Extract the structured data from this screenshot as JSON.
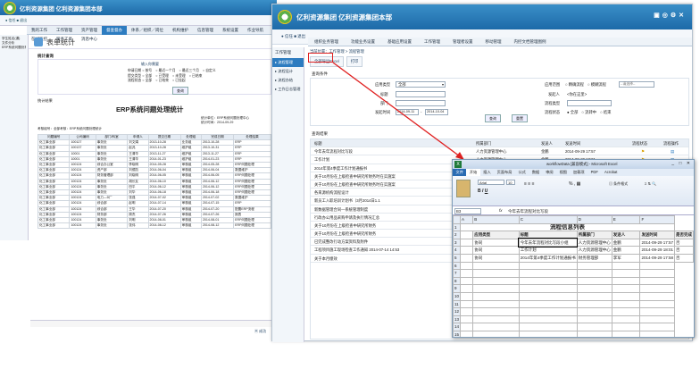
{
  "company_title": "亿利资源集团 亿利资源集团本部",
  "back_win": {
    "nav_tabs": [
      "我的工作",
      "工作管理",
      "资产管理",
      "督查督办",
      "体系／组织／岗位",
      "机构维护",
      "信息管理",
      "系统设置",
      "作业导航",
      "在线监控",
      "服务工具",
      "消息中心"
    ],
    "active_tab_index": 3,
    "page_title": "表单统计",
    "side_items": [
      "学生姓名(课)",
      "文件分析",
      "ERP系统问题处理统计"
    ],
    "search_label": "统计查询",
    "filter_title": "输入你需要",
    "filter_rows": [
      [
        "申请日期 ○ 按号",
        "○ 最近一个月",
        "○ 最近三个月",
        "○ 自定义"
      ],
      [
        "提交类型 ○ 全部",
        "○ 已受理",
        "○ 未受理",
        "○ 已结束"
      ],
      [
        "流程状态 ○ 全部",
        "○ 已结束",
        "○ 已挂起"
      ]
    ],
    "query_btn": "查询",
    "result_label": "统计结果",
    "report_title": "ERP系统问题处理统计",
    "report_meta": [
      "统计单位：ERP系统问题处理中心",
      "统计时间：2014-09-29"
    ],
    "report_sub": "考核组号：全部考核：ERP系统问题处理统计",
    "columns": [
      "问题编号",
      "公司编码",
      "部门/科室",
      "申请人",
      "提交日期",
      "处理组",
      "完成日期",
      "处理结果"
    ],
    "rows": [
      [
        "化工事业部",
        "100127",
        "事务处",
        "刘文娟",
        "2013-10-28",
        "业务组",
        "2013-10-28",
        "ERP"
      ],
      [
        "化工事业部",
        "100137",
        "事务处",
        "赵兆",
        "2013-10-28",
        "维护组",
        "2013-10-31",
        "ERP"
      ],
      [
        "化工事业部",
        "10001",
        "事务处",
        "王清华",
        "2013-11-27",
        "维护组",
        "2013-11-27",
        "ERP"
      ],
      [
        "化工事业部",
        "10001",
        "事务处",
        "王清华",
        "2014-01-23",
        "维护组",
        "2014-01-23",
        "ERP"
      ],
      [
        "化工事业部",
        "100124",
        "综合办公室",
        "李晓明",
        "2014-05-28",
        "审核组",
        "2014-05-28",
        "ERP问题处理"
      ],
      [
        "化工事业部",
        "100124",
        "资产部",
        "刘德凯",
        "2014-06-04",
        "审核组",
        "2014-06-04",
        "数据维护"
      ],
      [
        "化工事业部",
        "100124",
        "财务管理部",
        "刘晓明",
        "2014-06-05",
        "审核组",
        "2014-06-05",
        "ERP问题处理"
      ],
      [
        "化工事业部",
        "100124",
        "事务处",
        "胡长友",
        "2014-06-10",
        "审核组",
        "2014-06-12",
        "ERP问题处理"
      ],
      [
        "化工事业部",
        "100124",
        "事务处",
        "田平",
        "2014-06-12",
        "审核组",
        "2014-06-12",
        "ERP问题处理"
      ],
      [
        "化工事业部",
        "100124",
        "事务处",
        "刘华",
        "2014-06-18",
        "审核组",
        "2014-06-18",
        "ERP问题处理"
      ],
      [
        "化工事业部",
        "100124",
        "电力—D厂",
        "张强",
        "2014-07-02",
        "审核组",
        "2014-07-02",
        "数据维护"
      ],
      [
        "化工事业部",
        "100124",
        "综合部",
        "赵明",
        "2014-07-14",
        "审核组",
        "2014-07-15",
        "ERP"
      ],
      [
        "化工事业部",
        "100124",
        "综合部",
        "王华",
        "2014-07-20",
        "审核组",
        "2014-07-20",
        "配置ERP流程"
      ],
      [
        "化工事业部",
        "100124",
        "财务部",
        "周杰",
        "2014-07-26",
        "审核组",
        "2014-07-26",
        "报表"
      ],
      [
        "化工事业部",
        "100124",
        "事务处",
        "刘明",
        "2014-08-01",
        "审核组",
        "2014-08-01",
        "ERP问题处理"
      ],
      [
        "化工事业部",
        "100124",
        "事务处",
        "张伟",
        "2014-08-12",
        "审核组",
        "2014-08-12",
        "ERP问题处理"
      ]
    ]
  },
  "front_win": {
    "nav_tabs": [
      "组织业务管理",
      "功能业务设置",
      "基础应用设置",
      "工作管理",
      "管理者设置",
      "移动管理",
      "内控文档管理图例"
    ],
    "sidebar_title": "工作管理",
    "side_items": [
      "流程管理",
      "流程设计",
      "流程办结",
      "工作日志管理"
    ],
    "active_side_index": 0,
    "breadcrumb": "当前位置：工作管理 > 流程管理",
    "tool_tabs": [
      "全部导出Excel",
      "打印"
    ],
    "cond_label": "查询条件",
    "form": {
      "apply_type_label": "应用类型",
      "apply_type_value": "全部",
      "title_label": "标题",
      "title_value": "",
      "dept_label": "部门",
      "dept_value": "",
      "date_label": "发起时间",
      "date_from": "2014-09-11",
      "date_to": "2014-10-04",
      "scope_label": "应用范围",
      "scope_opts": [
        "○ 精确流程",
        "○ 模糊流程"
      ],
      "scope_placeholder": "--请选择--",
      "initiator_label": "发起人",
      "initiator_value": "<你在这里>",
      "flow_type_label": "流程类型",
      "flow_state_label": "流程状态",
      "flow_state_opts": [
        "● 全部",
        "○ 流转中",
        "○ 结束"
      ],
      "query_btn": "查询",
      "reset_btn": "重置"
    },
    "result_label": "查询结果",
    "list_headers": [
      "标题",
      "所属部门",
      "发送人",
      "发送时间",
      "流程状态",
      "流程操作"
    ],
    "list_rows": [
      {
        "title": "今年去年流程对比写段",
        "dept": "人力资源管理中心",
        "sender": "金鹏",
        "time": "2014-09-29 17:57"
      },
      {
        "title": "工作计划",
        "dept": "人力资源管理中心",
        "sender": "金鹏",
        "time": "2014-09-29 18:01"
      },
      {
        "title": "2014年第4季度工作计划通报书",
        "dept": "",
        "sender": "",
        "time": ""
      },
      {
        "title": "关于10月份在上级检查中研究所财务时在实施案",
        "dept": "",
        "sender": "",
        "time": ""
      },
      {
        "title": "关于10月份在上级检查中研究所财务时在实施案",
        "dept": "",
        "sender": "",
        "time": ""
      },
      {
        "title": "各来源机构流程设计",
        "dept": "",
        "sender": "",
        "time": ""
      },
      {
        "title": "新员工入职培训计划书（3月2014日1.1",
        "dept": "",
        "sender": "",
        "time": ""
      },
      {
        "title": "新数据管理合同—系统管理制度",
        "dept": "",
        "sender": "",
        "time": ""
      },
      {
        "title": "行政办公用品采购申请及执行情况汇总",
        "dept": "",
        "sender": "",
        "time": ""
      },
      {
        "title": "关于10月份在上级检查中研究所财务",
        "dept": "",
        "sender": "",
        "time": ""
      },
      {
        "title": "关于10月份在上级检查中研究所财务",
        "dept": "",
        "sender": "",
        "time": ""
      },
      {
        "title": "已完成整改行动方案资料及附件",
        "dept": "",
        "sender": "",
        "time": ""
      },
      {
        "title": "工程项目施工现场检查工作通知 2014-07-14 14:53",
        "dept": "",
        "sender": "",
        "time": ""
      },
      {
        "title": "关于本月绩效",
        "dept": "",
        "sender": "",
        "time": ""
      }
    ],
    "status_bar": [
      "成功(0)",
      "通知(0)"
    ]
  },
  "excel": {
    "title": "workflowData [兼容模式] - Microsoft Excel",
    "ribbon_tabs": [
      "文件",
      "开始",
      "插入",
      "页面布局",
      "公式",
      "数据",
      "审阅",
      "视图",
      "加载项",
      "PDF",
      "Acrobat"
    ],
    "font_name": "Arial",
    "font_size": "10",
    "namebox": "B3",
    "formula": "今年去年流程对比写段",
    "sheet_title": "流程信息列表",
    "headers": [
      "应用类型",
      "标题",
      "所属部门",
      "发送人",
      "发送时间",
      "是否完成"
    ],
    "rows": [
      [
        "协同",
        "今年去年流程对比写段小组",
        "人力资源管理中心",
        "金鹏",
        "2014-09-29 17:57",
        "否"
      ],
      [
        "协同",
        "工作计划",
        "人力资源管理中心",
        "金鹏",
        "2014-09-29 18:01",
        "否"
      ],
      [
        "协同",
        "2014年第4季度工作计划通报书",
        "财务管理部",
        "李军",
        "2014-09-29 17:58",
        "否"
      ]
    ]
  },
  "colors": {
    "accent": "#2d7cc0",
    "arrow": "#e02020",
    "highlight": "#e02020"
  }
}
